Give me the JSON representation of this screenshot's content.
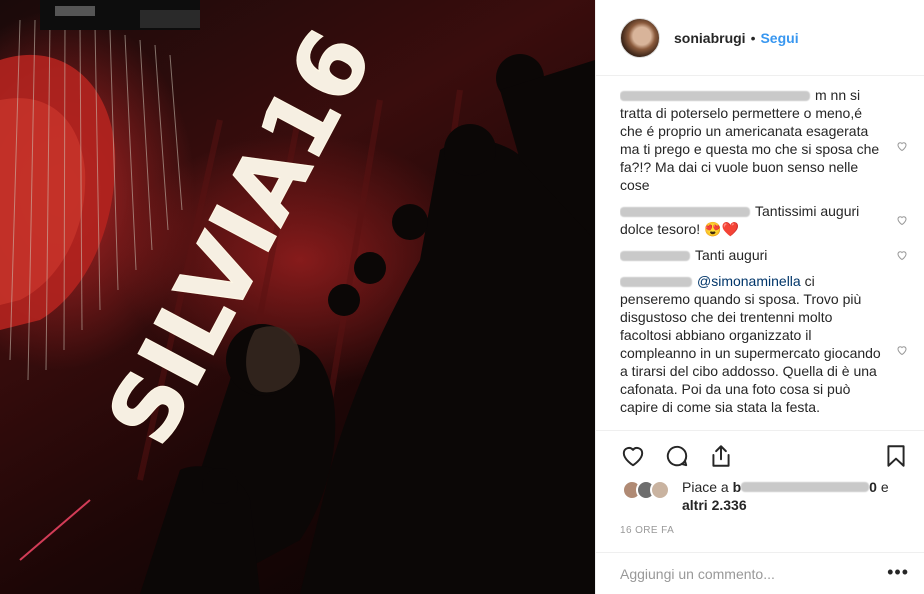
{
  "post": {
    "username": "soniabrugi",
    "separator": "•",
    "follow_label": "Segui",
    "photo": {
      "sign_text": "SILVIA16"
    },
    "comments": [
      {
        "user": "",
        "mention": "",
        "text": "m nn si tratta di poterselo permettere o meno,é che é proprio un americanata esagerata ma ti prego e questa mo che si sposa che fa?!? Ma dai ci vuole buon senso nelle cose"
      },
      {
        "user": "",
        "mention": "",
        "text": "Tantissimi auguri dolce tesoro! 😍❤️"
      },
      {
        "user": "",
        "mention": "",
        "text": "Tanti auguri"
      },
      {
        "user": "",
        "mention": "@simonaminella",
        "text": " ci penseremo quando si sposa. Trovo più disgustoso che dei trentenni molto facoltosi abbiano organizzato il compleanno in un supermercato giocando a tirarsi del cibo addosso. Quella di è una cafonata. Poi da una foto cosa si può capire di come sia stata la festa."
      }
    ],
    "actions": {
      "like_icon": "heart-outline-icon",
      "comment_icon": "comment-bubble-icon",
      "share_icon": "share-upload-icon",
      "save_icon": "bookmark-icon"
    },
    "likes": {
      "prefix": "Piace a",
      "lead_char": "b",
      "suffix_char": "0",
      "and_word": "e",
      "others_text": "altri 2.336"
    },
    "timestamp": "16 ORE FA",
    "add_comment": {
      "placeholder": "Aggiungi un commento...",
      "more_label": "•••"
    }
  }
}
